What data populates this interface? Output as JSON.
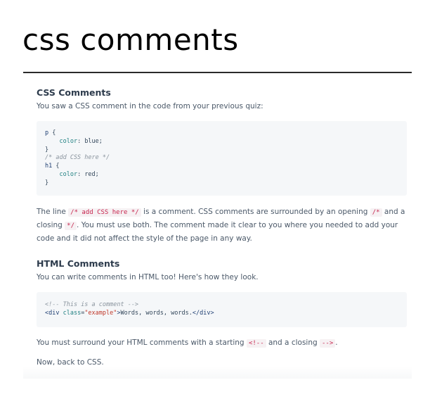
{
  "page_title": "css comments",
  "css_section": {
    "heading": "CSS Comments",
    "intro": "You saw a CSS comment in the code from your previous quiz:",
    "code": {
      "line1_sel": "p",
      "line1_brace": " {",
      "line2_prop": "color",
      "line2_val": ": blue;",
      "line3": "}",
      "line4": "/* add CSS here */",
      "line5_sel": "h1",
      "line5_brace": " {",
      "line6_prop": "color",
      "line6_val": ": red;",
      "line7": "}"
    },
    "para_1": "The line ",
    "code_1": "/* add CSS here */",
    "para_2": " is a comment. CSS comments are surrounded by an opening ",
    "code_2": "/*",
    "para_3": " and a closing ",
    "code_3": "*/",
    "para_4": ". You must use both. The comment made it clear to you where you needed to add your code and it did not affect the style of the page in any way."
  },
  "html_section": {
    "heading": "HTML Comments",
    "intro": "You can write comments in HTML too! Here's how they look.",
    "code": {
      "line1": "<!-- This is a comment -->",
      "line2_open": "<div ",
      "line2_attr": "class",
      "line2_eq": "=",
      "line2_val": "\"example\"",
      "line2_gt": ">",
      "line2_text": "Words, words, words.",
      "line2_close": "</div>"
    },
    "para_1": "You must surround your HTML comments with a starting ",
    "code_1": "<!--",
    "para_2": " and a closing ",
    "code_2": "-->",
    "para_3": ".",
    "closing": "Now, back to CSS."
  }
}
